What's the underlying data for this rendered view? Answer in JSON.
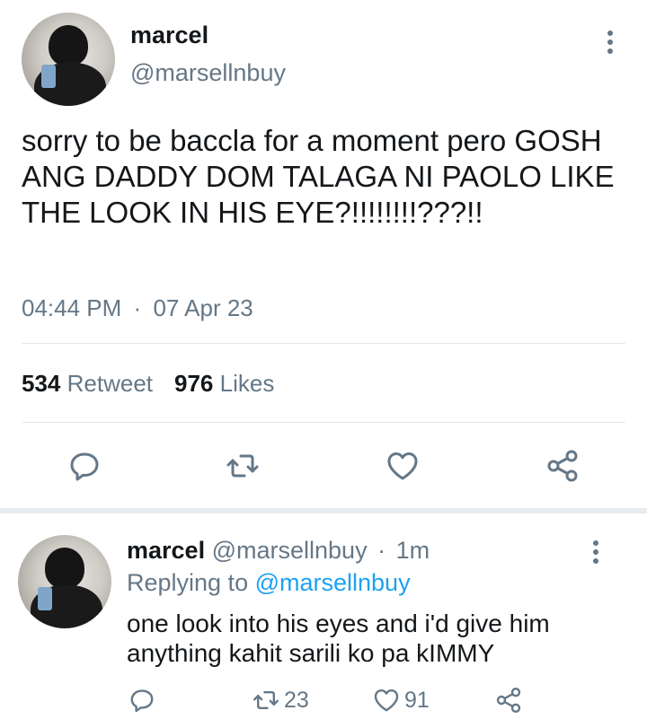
{
  "tweet": {
    "author_name": "marcel",
    "author_handle": "@marsellnbuy",
    "text": "sorry to be baccla for a moment pero GOSH ANG DADDY DOM TALAGA NI PAOLO LIKE THE LOOK IN HIS EYE?!!!!!!!!???!!",
    "time": "04:44 PM",
    "separator": "·",
    "date": "07 Apr 23",
    "retweet_count": "534",
    "retweet_label": "Retweet",
    "like_count": "976",
    "like_label": "Likes",
    "icons": [
      "reply-icon",
      "retweet-icon",
      "like-icon",
      "share-icon",
      "more-icon"
    ]
  },
  "reply": {
    "author_name": "marcel",
    "author_handle": "@marsellnbuy",
    "separator": "·",
    "age": "1m",
    "replying_prefix": "Replying to",
    "replying_to": "@marsellnbuy",
    "text": "one look into his eyes and i'd give him anything kahit sarili ko pa kIMMY",
    "retweet_count": "23",
    "like_count": "91"
  },
  "colors": {
    "accent": "#1da1f2",
    "text": "#14171a",
    "secondary": "#657786",
    "divider": "#e1e8ed"
  }
}
